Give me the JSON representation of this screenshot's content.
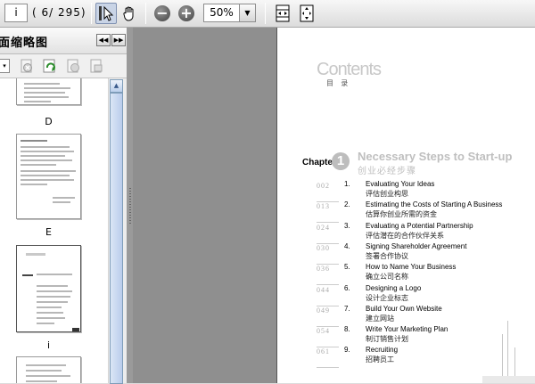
{
  "toolbar": {
    "current_page": "i",
    "page_count": "( 6/ 295)",
    "zoom": "50%",
    "icons": [
      "select-tool-icon",
      "hand-tool-icon",
      "zoom-out-icon",
      "zoom-in-icon",
      "fit-width-icon",
      "fit-page-icon"
    ]
  },
  "panel": {
    "title": "面缩略图",
    "thumb_labels": [
      "D",
      "E",
      "i"
    ]
  },
  "document": {
    "contents_title": "Contents",
    "contents_cn": "目 录",
    "chapter_label": "Chapter",
    "chapter_number": "1",
    "chapter_title": "Necessary Steps to Start-up",
    "chapter_cn": "创业必经步骤",
    "toc": [
      {
        "page": "002",
        "num": "1.",
        "en": "Evaluating Your Ideas",
        "cn": "评估创业构思"
      },
      {
        "page": "013",
        "num": "2.",
        "en": "Estimating the Costs of Starting A Business",
        "cn": "估算你创业所需的资金"
      },
      {
        "page": "024",
        "num": "3.",
        "en": "Evaluating a Potential Partnership",
        "cn": "评估潜在的合作伙伴关系"
      },
      {
        "page": "030",
        "num": "4.",
        "en": "Signing Shareholder Agreement",
        "cn": "签署合作协议"
      },
      {
        "page": "036",
        "num": "5.",
        "en": "How to Name Your Business",
        "cn": "确立公司名称"
      },
      {
        "page": "044",
        "num": "6.",
        "en": "Designing a Logo",
        "cn": "设计企业标志"
      },
      {
        "page": "049",
        "num": "7.",
        "en": "Build Your Own Website",
        "cn": "建立网站"
      },
      {
        "page": "054",
        "num": "8.",
        "en": "Write Your Marketing Plan",
        "cn": "制订销售计划"
      },
      {
        "page": "061",
        "num": "9.",
        "en": "Recruiting",
        "cn": "招聘员工"
      }
    ]
  }
}
